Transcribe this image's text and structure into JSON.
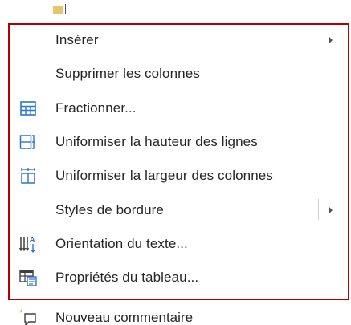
{
  "menu": {
    "items": [
      {
        "key": "insert",
        "label": "Insérer",
        "has_submenu": true
      },
      {
        "key": "delete_columns",
        "label": "Supprimer les colonnes",
        "has_submenu": false
      },
      {
        "key": "split",
        "label": "Fractionner...",
        "has_submenu": false,
        "icon": "split-cells-icon"
      },
      {
        "key": "distribute_rows",
        "label": "Uniformiser la hauteur des lignes",
        "has_submenu": false,
        "icon": "distribute-rows-icon"
      },
      {
        "key": "distribute_columns",
        "label": "Uniformiser la largeur des colonnes",
        "has_submenu": false,
        "icon": "distribute-columns-icon"
      },
      {
        "key": "border_styles",
        "label": "Styles de bordure",
        "has_submenu": true
      },
      {
        "key": "text_direction",
        "label": "Orientation du texte...",
        "has_submenu": false,
        "icon": "text-direction-icon"
      },
      {
        "key": "table_properties",
        "label": "Propriétés du tableau...",
        "has_submenu": false,
        "icon": "table-properties-icon"
      }
    ]
  },
  "bottom": {
    "label": "Nouveau commentaire",
    "icon": "new-comment-icon"
  },
  "colors": {
    "highlight": "#b20000",
    "icon_blue": "#2e75c8",
    "text": "#262626"
  }
}
